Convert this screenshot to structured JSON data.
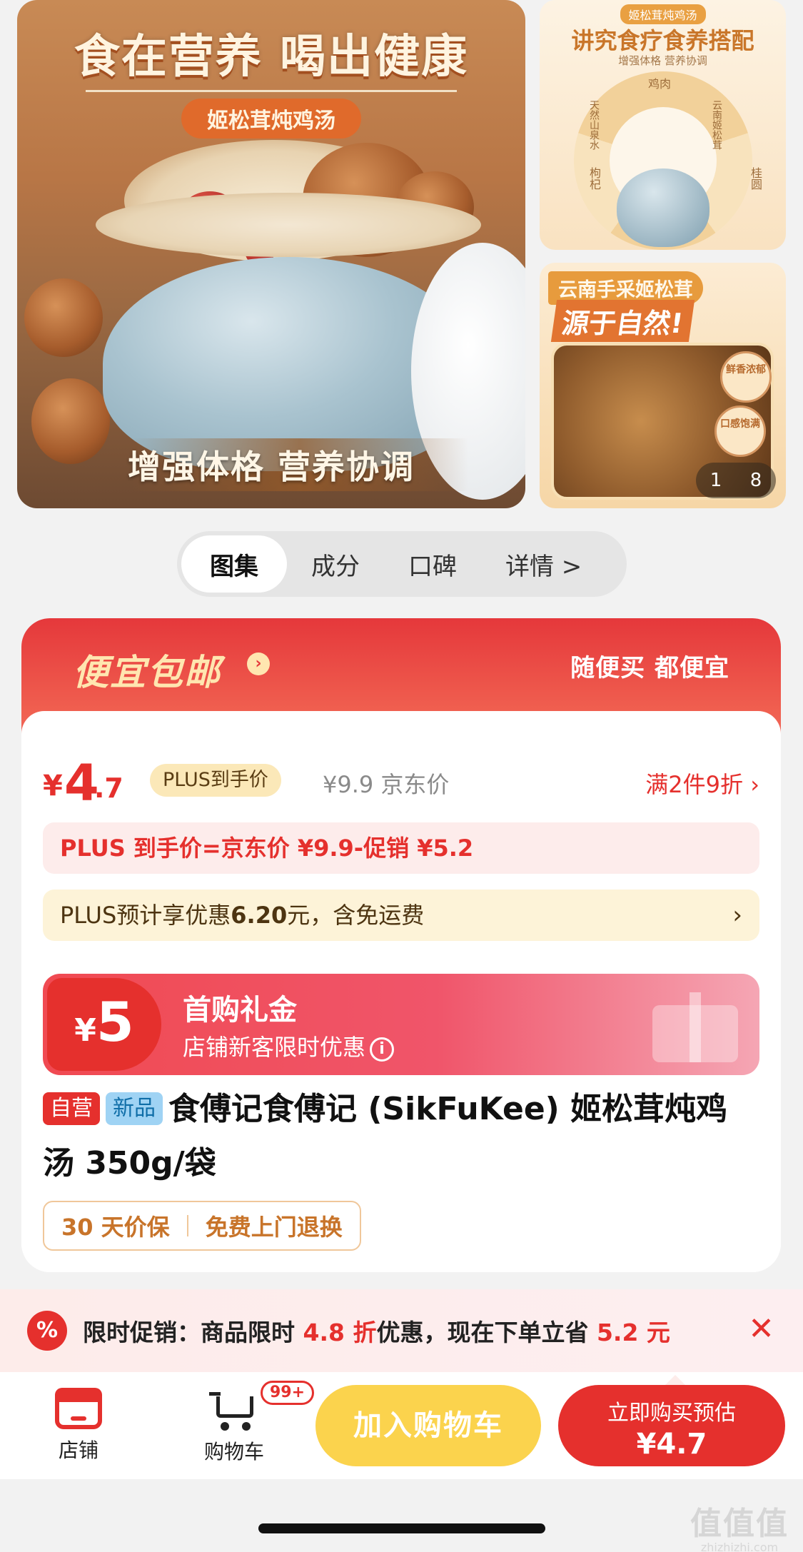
{
  "gallery": {
    "main": {
      "headline": "食在营养 喝出健康",
      "pill": "姬松茸炖鸡汤",
      "bottom_text": "增强体格 营养协调"
    },
    "side1": {
      "tag": "姬松茸炖鸡汤",
      "title": "讲究食疗食养搭配",
      "subtitle": "增强体格  营养协调",
      "ring_labels": [
        "鸡肉",
        "云南姬松茸",
        "桂圆",
        "枸杞",
        "天然山泉水"
      ]
    },
    "side2": {
      "banner": "云南手采姬松茸",
      "big": "源于自然!",
      "seal1": "鲜香浓郁",
      "seal2": "口感饱满",
      "counter_current": "1",
      "counter_total": "8"
    }
  },
  "tabs": [
    {
      "label": "图集",
      "active": true
    },
    {
      "label": "成分"
    },
    {
      "label": "口碑"
    },
    {
      "label": "详情 >"
    }
  ],
  "promo_card": {
    "brand": "便宜包邮",
    "brand_arrow": "›",
    "slogan": "随便买 都便宜",
    "price": {
      "currency": "¥",
      "integer": "4",
      "decimal": ".7",
      "plus_label": "PLUS到手价"
    },
    "jd_price": "¥9.9 京东价",
    "discount_link": "满2件9折 ›",
    "formula": "PLUS 到手价=京东价 ¥9.9-促销 ¥5.2",
    "plus_estimate": {
      "prefix": "PLUS预计享优惠",
      "amount": "6.20",
      "suffix": "元，含免运费",
      "chevron": "›"
    },
    "coupon": {
      "currency": "¥",
      "amount": "5",
      "title": "首购礼金",
      "desc": "店铺新客限时优惠",
      "info": "i"
    },
    "product": {
      "badge_self": "自营",
      "badge_new": "新品",
      "title": "食傅记食傅记 (SikFuKee) 姬松茸炖鸡汤 350g/袋"
    },
    "services": [
      "30 天价保",
      "免费上门退换"
    ]
  },
  "promo_bar": {
    "icon": "%",
    "prefix": "限时促销：商品限时 ",
    "discount": "4.8 折",
    "middle": "优惠，现在下单立省 ",
    "saving": "5.2 元",
    "close": "✕"
  },
  "bottom_bar": {
    "store_label": "店铺",
    "cart_label": "购物车",
    "cart_badge": "99+",
    "add_to_cart": "加入购物车",
    "buy_now_line1": "立即购买预估",
    "buy_now_line2": "¥4.7"
  },
  "watermark": {
    "glyphs": "值值值",
    "url": "zhizhizhi.com"
  },
  "colors": {
    "accent_red": "#e5302d",
    "cart_yellow": "#fbd34d",
    "plus_gold": "#fbe8b8"
  }
}
